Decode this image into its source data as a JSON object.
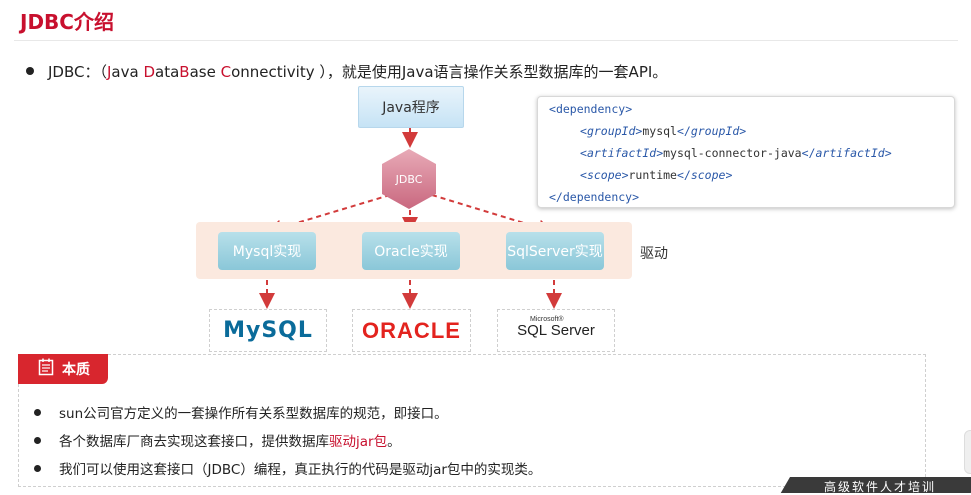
{
  "title": "JDBC介绍",
  "intro": {
    "prefix": "JDBC：（",
    "j": "J",
    "ava": "ava ",
    "d": "D",
    "ata": "ata",
    "b": "B",
    "ase": "ase ",
    "c": "C",
    "onnectivity": "onnectivity ）",
    "suffix": "，就是使用Java语言操作关系型数据库的一套API。"
  },
  "diagram": {
    "java_program": "Java程序",
    "jdbc": "JDBC",
    "impls": [
      "Mysql实现",
      "Oracle实现",
      "SqlServer实现"
    ],
    "driver_label": "驱动",
    "logos": {
      "mysql_my": "MySQL",
      "mysql_sql": "",
      "oracle": "ORACLE",
      "sqlserver_ms": "Microsoft®",
      "sqlserver": "SQL Server"
    }
  },
  "code": {
    "open_tag": "dependency",
    "group_tag": "groupId",
    "group_val": "mysql",
    "artifact_tag": "artifactId",
    "artifact_val": "mysql-connector-java",
    "scope_tag": "scope",
    "scope_val": "runtime",
    "close_tag": "dependency"
  },
  "essence": {
    "badge": "本质",
    "items": [
      {
        "text": "sun公司官方定义的一套操作所有关系型数据库的规范，即接口。"
      },
      {
        "before": "各个数据库厂商去实现这套接口，提供数据库",
        "highlight": "驱动jar包",
        "after": "。"
      },
      {
        "text": "我们可以使用这套接口（JDBC）编程，真正执行的代码是驱动jar包中的实现类。"
      }
    ]
  },
  "footer": "高级软件人才培训",
  "colors": {
    "accent": "#c8102e",
    "hex": "#d98a9a",
    "impl": "#8ac7d8",
    "arrow": "#d23b3b"
  }
}
